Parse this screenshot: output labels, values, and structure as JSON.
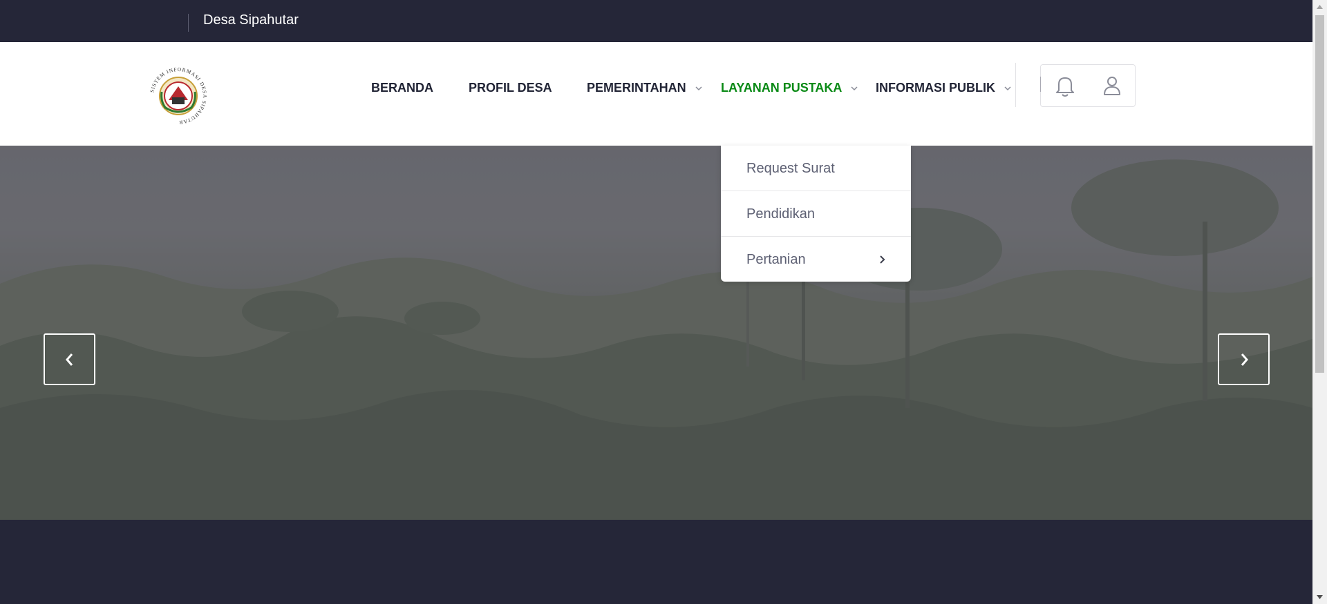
{
  "topbar": {
    "site_name": "Desa Sipahutar"
  },
  "header": {
    "logo": {
      "icon": "village-emblem-logo",
      "ring_text": "SISTEM INFORMASI DESA SIPAHUTAR"
    },
    "nav": [
      {
        "label": "BERANDA",
        "has_dropdown": false,
        "active": false
      },
      {
        "label": "PROFIL DESA",
        "has_dropdown": false,
        "active": false
      },
      {
        "label": "PEMERINTAHAN",
        "has_dropdown": true,
        "active": false
      },
      {
        "label": "LAYANAN PUSTAKA",
        "has_dropdown": true,
        "active": true
      },
      {
        "label": "INFORMASI PUBLIK",
        "has_dropdown": true,
        "active": false
      }
    ],
    "icons": {
      "notification": "bell-icon",
      "account": "user-icon"
    }
  },
  "dropdown": {
    "items": [
      {
        "label": "Request Surat",
        "has_submenu": false
      },
      {
        "label": "Pendidikan",
        "has_submenu": false
      },
      {
        "label": "Pertanian",
        "has_submenu": true
      }
    ]
  },
  "hero": {
    "image": "misty-forest-landscape",
    "prev_icon": "chevron-left-icon",
    "next_icon": "chevron-right-icon"
  },
  "colors": {
    "dark_bg": "#252638",
    "nav_text": "#222536",
    "active_nav": "#0a8a16",
    "dropdown_text": "#5d6073"
  }
}
